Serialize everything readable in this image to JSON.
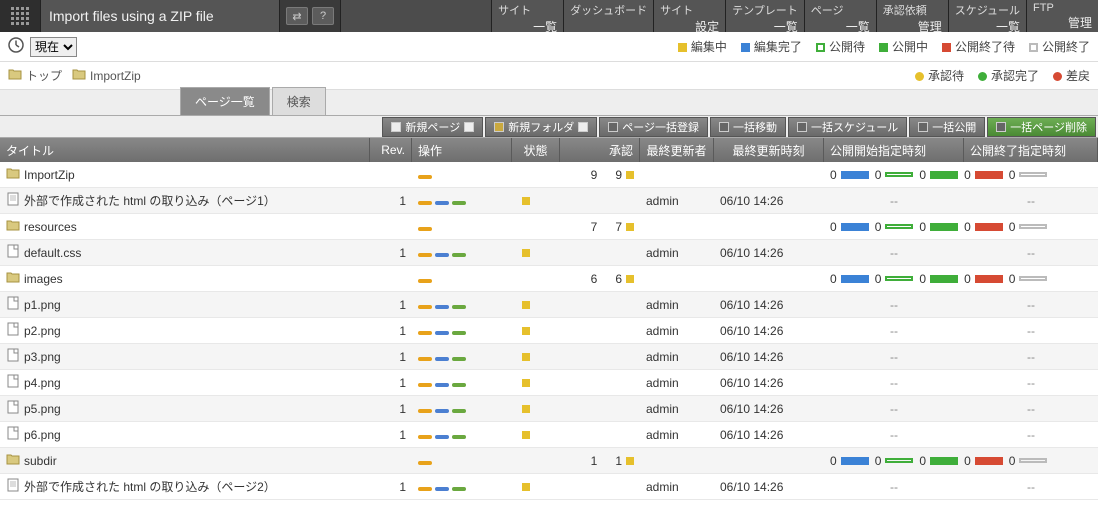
{
  "app": {
    "title": "Import files using a ZIP file"
  },
  "topmenu": [
    {
      "title": "サイト",
      "sub": "一覧"
    },
    {
      "title": "ダッシュボード",
      "sub": ""
    },
    {
      "title": "サイト",
      "sub": "設定"
    },
    {
      "title": "テンプレート",
      "sub": "一覧"
    },
    {
      "title": "ページ",
      "sub": "一覧"
    },
    {
      "title": "承認依頼",
      "sub": "管理"
    },
    {
      "title": "スケジュール",
      "sub": "一覧"
    },
    {
      "title": "FTP",
      "sub": "管理"
    }
  ],
  "now_select": "現在",
  "legend1": [
    {
      "label": "編集中",
      "color": "#e6c02c",
      "shape": "sq"
    },
    {
      "label": "編集完了",
      "color": "#3b82d6",
      "shape": "sq"
    },
    {
      "label": "公開待",
      "color": "#3fae3a",
      "shape": "sqo"
    },
    {
      "label": "公開中",
      "color": "#3fae3a",
      "shape": "sq"
    },
    {
      "label": "公開終了待",
      "color": "#d64a33",
      "shape": "sq"
    },
    {
      "label": "公開終了",
      "color": "#bbb",
      "shape": "sqo"
    }
  ],
  "breadcrumb": [
    {
      "label": "トップ"
    },
    {
      "label": "ImportZip"
    }
  ],
  "legend2": [
    {
      "label": "承認待",
      "color": "#e6c02c"
    },
    {
      "label": "承認完了",
      "color": "#3fae3a"
    },
    {
      "label": "差戻",
      "color": "#d64a33"
    }
  ],
  "tabs": [
    {
      "label": "ページ一覧",
      "active": true
    },
    {
      "label": "検索",
      "active": false
    }
  ],
  "toolbar": [
    {
      "label": "新規ページ",
      "icon": "page"
    },
    {
      "label": "新規フォルダ",
      "icon": "folder"
    },
    {
      "label": "ページ一括登録"
    },
    {
      "label": "一括移動"
    },
    {
      "label": "一括スケジュール"
    },
    {
      "label": "一括公開"
    },
    {
      "label": "一括ページ削除",
      "selected": true
    }
  ],
  "columns": {
    "title": "タイトル",
    "rev": "Rev.",
    "ops": "操作",
    "stat": "状態",
    "appr": "承認",
    "user": "最終更新者",
    "time": "最終更新時刻",
    "start": "公開開始指定時刻",
    "end": "公開終了指定時刻"
  },
  "rows": [
    {
      "type": "folder",
      "indent": 0,
      "name": "ImportZip",
      "rev": "",
      "ops": "single",
      "stat": "",
      "appr": [
        "9",
        "9"
      ],
      "counts": [
        "0",
        "0",
        "0",
        "0",
        "0"
      ],
      "user": "",
      "time": "",
      "start": "",
      "end": ""
    },
    {
      "type": "page",
      "indent": 1,
      "name": "外部で作成された html の取り込み（ページ1）",
      "rev": "1",
      "ops": "triple",
      "stat": "y",
      "appr": null,
      "user": "admin",
      "time": "06/10 14:26",
      "start": "--",
      "end": "--"
    },
    {
      "type": "folder",
      "indent": 1,
      "name": "resources",
      "rev": "",
      "ops": "single",
      "stat": "",
      "appr": [
        "7",
        "7"
      ],
      "counts": [
        "0",
        "0",
        "0",
        "0",
        "0"
      ],
      "user": "",
      "time": "",
      "start": "",
      "end": ""
    },
    {
      "type": "file",
      "indent": 2,
      "name": "default.css",
      "rev": "1",
      "ops": "triple",
      "stat": "y",
      "appr": null,
      "user": "admin",
      "time": "06/10 14:26",
      "start": "--",
      "end": "--"
    },
    {
      "type": "folder",
      "indent": 2,
      "name": "images",
      "rev": "",
      "ops": "single",
      "stat": "",
      "appr": [
        "6",
        "6"
      ],
      "counts": [
        "0",
        "0",
        "0",
        "0",
        "0"
      ],
      "user": "",
      "time": "",
      "start": "",
      "end": ""
    },
    {
      "type": "file",
      "indent": 3,
      "name": "p1.png",
      "rev": "1",
      "ops": "triple",
      "stat": "y",
      "appr": null,
      "user": "admin",
      "time": "06/10 14:26",
      "start": "--",
      "end": "--"
    },
    {
      "type": "file",
      "indent": 3,
      "name": "p2.png",
      "rev": "1",
      "ops": "triple",
      "stat": "y",
      "appr": null,
      "user": "admin",
      "time": "06/10 14:26",
      "start": "--",
      "end": "--"
    },
    {
      "type": "file",
      "indent": 3,
      "name": "p3.png",
      "rev": "1",
      "ops": "triple",
      "stat": "y",
      "appr": null,
      "user": "admin",
      "time": "06/10 14:26",
      "start": "--",
      "end": "--"
    },
    {
      "type": "file",
      "indent": 3,
      "name": "p4.png",
      "rev": "1",
      "ops": "triple",
      "stat": "y",
      "appr": null,
      "user": "admin",
      "time": "06/10 14:26",
      "start": "--",
      "end": "--"
    },
    {
      "type": "file",
      "indent": 3,
      "name": "p5.png",
      "rev": "1",
      "ops": "triple",
      "stat": "y",
      "appr": null,
      "user": "admin",
      "time": "06/10 14:26",
      "start": "--",
      "end": "--"
    },
    {
      "type": "file",
      "indent": 3,
      "name": "p6.png",
      "rev": "1",
      "ops": "triple",
      "stat": "y",
      "appr": null,
      "user": "admin",
      "time": "06/10 14:26",
      "start": "--",
      "end": "--"
    },
    {
      "type": "folder",
      "indent": 1,
      "name": "subdir",
      "rev": "",
      "ops": "single",
      "stat": "",
      "appr": [
        "1",
        "1"
      ],
      "counts": [
        "0",
        "0",
        "0",
        "0",
        "0"
      ],
      "user": "",
      "time": "",
      "start": "",
      "end": ""
    },
    {
      "type": "page",
      "indent": 2,
      "name": "外部で作成された html の取り込み（ページ2）",
      "rev": "1",
      "ops": "triple",
      "stat": "y",
      "appr": null,
      "user": "admin",
      "time": "06/10 14:26",
      "start": "--",
      "end": "--"
    }
  ],
  "colors": {
    "count_markers": [
      "#3b82d6",
      "#3fae3a",
      "#3fae3a",
      "#d64a33",
      "#bbb"
    ],
    "count_shapes": [
      "sq",
      "sqo",
      "sq",
      "sq",
      "sqo"
    ]
  }
}
